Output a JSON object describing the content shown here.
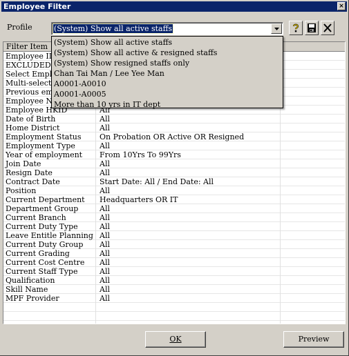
{
  "window": {
    "title": "Employee Filter",
    "close_glyph": "×"
  },
  "profile": {
    "label": "Profile",
    "selected": "(System) Show all active staffs",
    "options": [
      "(System) Show all active staffs",
      "(System) Show all active & resigned staffs",
      "(System) Show resigned staffs only",
      "Chan Tai Man / Lee Yee Man",
      "A0001-A0010",
      "A0001-A0005",
      "More than 10 yrs in IT dept"
    ]
  },
  "toolbar": {
    "icons": [
      "help-icon",
      "save-icon",
      "delete-icon"
    ]
  },
  "grid": {
    "columns": [
      "Filter Item",
      "",
      ""
    ],
    "rows": [
      {
        "item": "Employee ID",
        "value": ""
      },
      {
        "item": "EXCLUDED",
        "value": ""
      },
      {
        "item": "Select Employ",
        "value": ""
      },
      {
        "item": "Multi-select E",
        "value": ""
      },
      {
        "item": "Previous empl",
        "value": ""
      },
      {
        "item": "Employee Na",
        "value": ""
      },
      {
        "item": "Employee HKID",
        "value": "All"
      },
      {
        "item": "Date of Birth",
        "value": "All"
      },
      {
        "item": "Home District",
        "value": "All"
      },
      {
        "item": "Employment Status",
        "value": "On Probation OR Active OR Resigned"
      },
      {
        "item": "Employment Type",
        "value": "All"
      },
      {
        "item": "Year of employment",
        "value": "From 10Yrs To 99Yrs"
      },
      {
        "item": "Join Date",
        "value": "All"
      },
      {
        "item": "Resign Date",
        "value": "All"
      },
      {
        "item": "Contract Date",
        "value": "Start Date: All / End Date: All"
      },
      {
        "item": "Position",
        "value": "All"
      },
      {
        "item": "Current Department",
        "value": "Headquarters OR IT"
      },
      {
        "item": "Department Group",
        "value": "All"
      },
      {
        "item": "Current Branch",
        "value": "All"
      },
      {
        "item": "Current Duty Type",
        "value": "All"
      },
      {
        "item": "Leave Entitle Planning",
        "value": "All"
      },
      {
        "item": "Current Duty Group",
        "value": "All"
      },
      {
        "item": "Current Grading",
        "value": "All"
      },
      {
        "item": "Current Cost Centre",
        "value": "All"
      },
      {
        "item": "Current Staff Type",
        "value": "All"
      },
      {
        "item": "Qualification",
        "value": "All"
      },
      {
        "item": "Skill Name",
        "value": "All"
      },
      {
        "item": "MPF Provider",
        "value": "All"
      },
      {
        "item": "",
        "value": ""
      },
      {
        "item": "",
        "value": ""
      },
      {
        "item": "",
        "value": ""
      },
      {
        "item": "",
        "value": ""
      }
    ]
  },
  "buttons": {
    "ok": "OK",
    "preview": "Preview"
  }
}
